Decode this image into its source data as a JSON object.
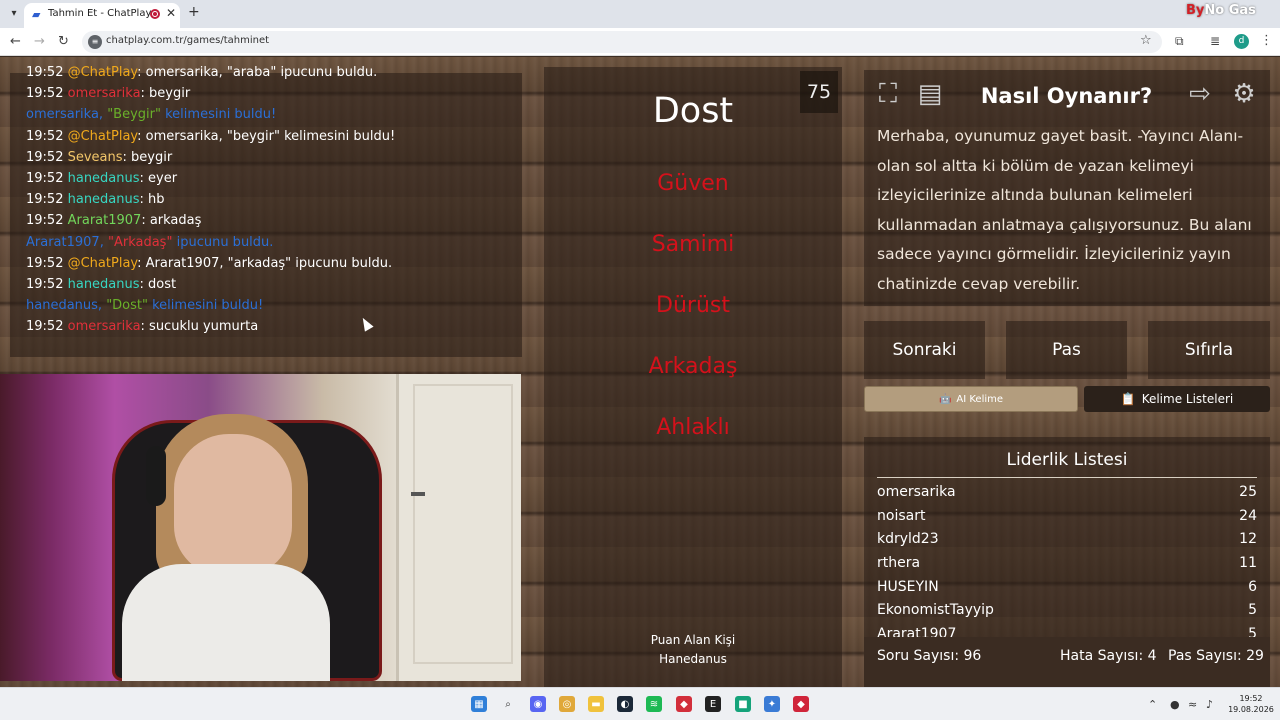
{
  "browser": {
    "tab_title": "Tahmin Et - ChatPlay",
    "url": "chatplay.com.tr/games/tahminet",
    "brand_prefix": "By",
    "brand_suffix": "No Gas"
  },
  "chat": {
    "messages": [
      {
        "time": "19:52",
        "user": "@ChatPlay",
        "text": ": omersarika, \"araba\" ipucunu buldu."
      },
      {
        "time": "19:52",
        "user": "omersarika",
        "text": ": beygir"
      },
      {
        "system": true,
        "user": "omersarika,",
        "word": "\"Beygir\"",
        "text": " kelimesini buldu!"
      },
      {
        "time": "19:52",
        "user": "@ChatPlay",
        "text": ": omersarika, \"beygir\" kelimesini buldu!"
      },
      {
        "time": "19:52",
        "user": "Seveans",
        "text": ": beygir"
      },
      {
        "time": "19:52",
        "user": "hanedanus",
        "text": ": eyer"
      },
      {
        "time": "19:52",
        "user": "hanedanus",
        "text": ": hb"
      },
      {
        "time": "19:52",
        "user": "Ararat1907",
        "text": ": arkadaş"
      },
      {
        "system": true,
        "user": "Ararat1907,",
        "word": "\"Arkadaş\"",
        "text": " ipucunu buldu."
      },
      {
        "time": "19:52",
        "user": "@ChatPlay",
        "text": ": Ararat1907, \"arkadaş\" ipucunu buldu."
      },
      {
        "time": "19:52",
        "user": "hanedanus",
        "text": ": dost"
      },
      {
        "system": true,
        "user": "hanedanus,",
        "word": "\"Dost\"",
        "text": " kelimesini buldu!"
      },
      {
        "time": "19:52",
        "user": "omersarika",
        "text": ": sucuklu yumurta"
      }
    ]
  },
  "game": {
    "counter": "75",
    "main_word": "Dost",
    "forbidden": [
      "Güven",
      "Samimi",
      "Dürüst",
      "Arkadaş",
      "Ahlaklı"
    ],
    "scorer_label": "Puan Alan Kişi",
    "scorer_name": "Hanedanus"
  },
  "how_to": {
    "title": "Nasıl Oynanır?",
    "text": "Merhaba, oyunumuz gayet basit. -Yayıncı Alanı- olan sol altta ki bölüm de yazan kelimeyi izleyicilerinize altında bulunan kelimeleri kullanmadan anlatmaya çalışıyorsunuz. Bu alanı sadece yayıncı görmelidir. İzleyicileriniz yayın chatinizde cevap verebilir."
  },
  "actions": {
    "next": "Sonraki",
    "pass": "Pas",
    "reset": "Sıfırla"
  },
  "ai_button": "AI Kelime",
  "lists_button": "Kelime Listeleri",
  "leaderboard": {
    "title": "Liderlik Listesi",
    "rows": [
      {
        "name": "omersarika",
        "score": "25"
      },
      {
        "name": "noisart",
        "score": "24"
      },
      {
        "name": "kdryld23",
        "score": "12"
      },
      {
        "name": "rthera",
        "score": "11"
      },
      {
        "name": "HUSEYIN",
        "score": "6"
      },
      {
        "name": "EkonomistTayyip",
        "score": "5"
      },
      {
        "name": "Ararat1907",
        "score": "5"
      }
    ]
  },
  "stats": {
    "questions": "Soru Sayısı: 96",
    "errors": "Hata Sayısı: 4",
    "passes": "Pas Sayısı: 29"
  },
  "clock": {
    "time": "19:52",
    "date": "19.08.2026"
  },
  "colors": {
    "accent_red": "#d4111b",
    "panel": "#2a1e16",
    "chat_system": "#2b6fd6"
  }
}
